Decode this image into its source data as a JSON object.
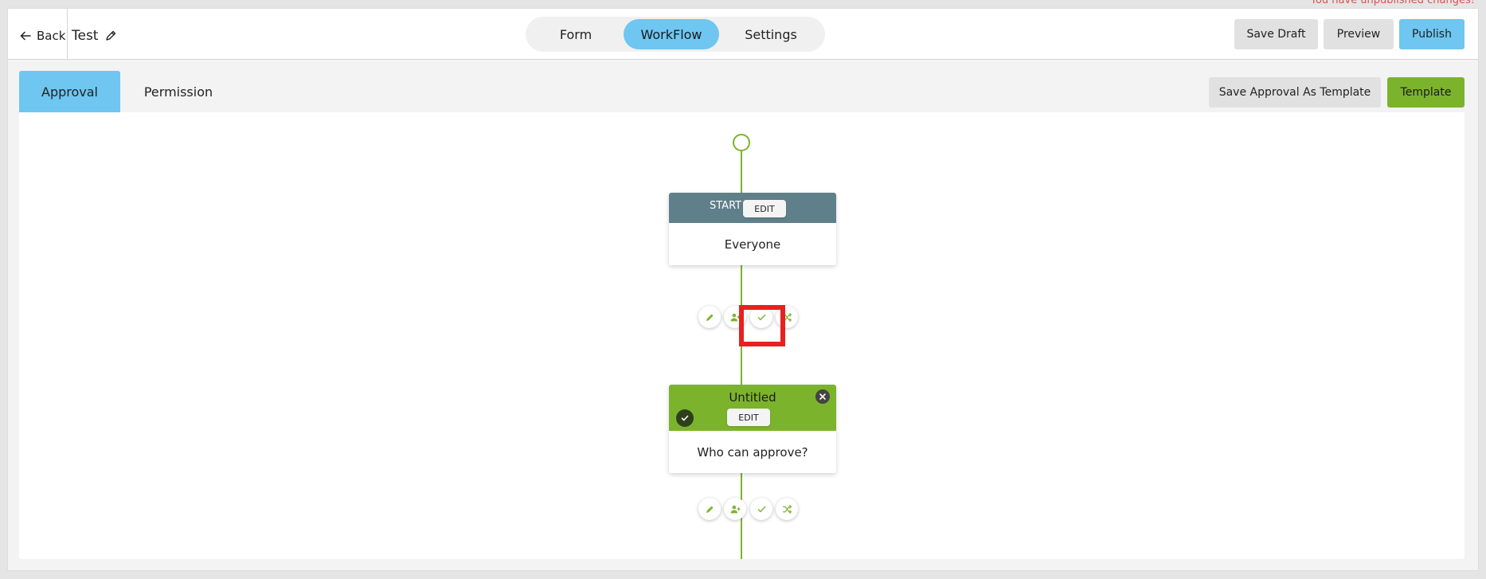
{
  "notice": "You have unpublished changes!",
  "header": {
    "back_label": "Back",
    "form_title": "Test",
    "segments": [
      {
        "label": "Form",
        "active": false
      },
      {
        "label": "WorkFlow",
        "active": true
      },
      {
        "label": "Settings",
        "active": false
      }
    ],
    "save_draft_label": "Save Draft",
    "preview_label": "Preview",
    "publish_label": "Publish"
  },
  "tabs": [
    {
      "label": "Approval",
      "active": true
    },
    {
      "label": "Permission",
      "active": false
    }
  ],
  "toolbar": {
    "save_template_label": "Save Approval As Template",
    "template_label": "Template"
  },
  "workflow": {
    "start_node": {
      "header": "START",
      "edit_label": "EDIT",
      "body": "Everyone"
    },
    "approval_node": {
      "title": "Untitled",
      "edit_label": "EDIT",
      "body": "Who can approve?"
    },
    "action_icons": [
      "pencil-icon",
      "add-user-icon",
      "check-icon",
      "shuffle-icon"
    ]
  },
  "colors": {
    "accent_blue": "#6ec6f1",
    "accent_green": "#7cb32c",
    "start_header": "#5f7f8b",
    "highlight_red": "#e82020",
    "notice_red": "#d9534f"
  }
}
